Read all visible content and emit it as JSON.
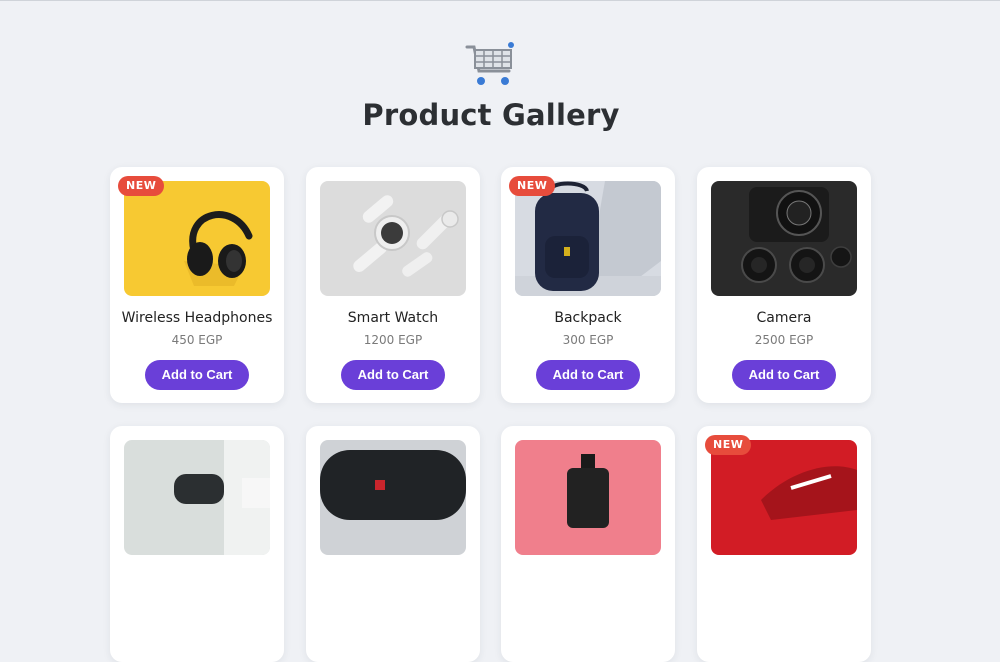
{
  "page": {
    "title": "Product Gallery"
  },
  "colors": {
    "accent": "#6a3fd8",
    "badge": "#e74c3c",
    "background": "#eff1f5"
  },
  "products": [
    {
      "name": "Wireless Headphones",
      "price": "450 EGP",
      "button": "Add to Cart",
      "badge": "NEW"
    },
    {
      "name": "Smart Watch",
      "price": "1200 EGP",
      "button": "Add to Cart",
      "badge": ""
    },
    {
      "name": "Backpack",
      "price": "300 EGP",
      "button": "Add to Cart",
      "badge": "NEW"
    },
    {
      "name": "Camera",
      "price": "2500 EGP",
      "button": "Add to Cart",
      "badge": ""
    },
    {
      "badge": ""
    },
    {
      "badge": ""
    },
    {
      "badge": ""
    },
    {
      "badge": "NEW"
    }
  ]
}
